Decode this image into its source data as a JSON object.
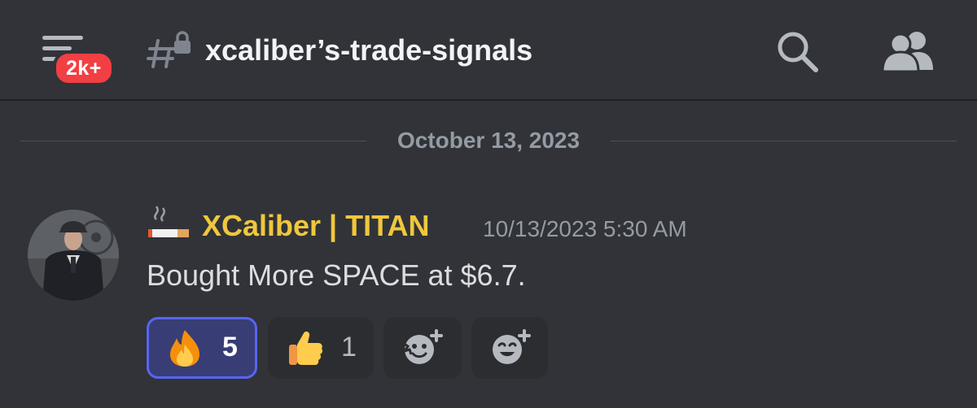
{
  "header": {
    "unread_badge": "2k+",
    "channel_name": "xcaliber’s-trade-signals",
    "icons": {
      "menu": "hamburger-menu-icon",
      "channel": "locked-text-channel-icon",
      "search": "search-icon",
      "members": "members-icon"
    }
  },
  "divider": {
    "date": "October 13, 2023"
  },
  "message": {
    "role_icon": "cigarette-emoji",
    "author": "XCaliber | TITAN",
    "author_color": "#f0c73c",
    "timestamp": "10/13/2023 5:30 AM",
    "content": "Bought More SPACE at $6.7.",
    "reactions": [
      {
        "emoji": "fire",
        "count": "5",
        "active": true
      },
      {
        "emoji": "thumbs-up",
        "count": "1",
        "active": false
      }
    ],
    "add_reaction_buttons": [
      {
        "icon": "add-super-reaction-icon"
      },
      {
        "icon": "add-reaction-icon"
      }
    ]
  },
  "colors": {
    "background": "#313338",
    "accent": "#5865f2",
    "badge": "#f23f43"
  }
}
